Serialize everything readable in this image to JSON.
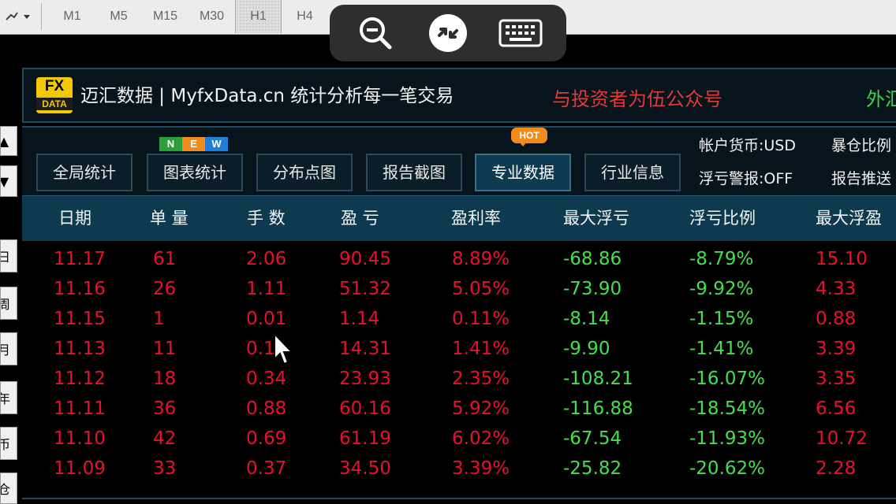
{
  "toolbar": {
    "timeframes": [
      "M1",
      "M5",
      "M15",
      "M30",
      "H1",
      "H4"
    ],
    "active_timeframe": "H1",
    "dropdown_icon": "chart-style-dropdown-icon"
  },
  "remote_controls": {
    "icons": [
      "zoom-out-icon",
      "remote-desktop-icon",
      "keyboard-icon"
    ]
  },
  "left_strip": {
    "arrows": [
      "▲",
      "▼"
    ],
    "buttons": [
      "日",
      "周",
      "月",
      "年",
      "币",
      "仓"
    ]
  },
  "banner": {
    "logo_top": "FX",
    "logo_bottom": "DATA",
    "brand_text": "迈汇数据 | MyfxData.cn  统计分析每一笔交易",
    "promo_text": "与投资者为伍公众号",
    "promo_text_2": "外汇",
    "colors": {
      "promo": "#e03a3a",
      "promo2": "#3fd04a",
      "logo": "#f2c800"
    }
  },
  "nav": {
    "buttons": [
      "全局统计",
      "图表统计",
      "分布点图",
      "报告截图",
      "专业数据",
      "行业信息"
    ],
    "active_index": 4,
    "new_badge": [
      "N",
      "E",
      "W"
    ],
    "new_badge_colors": [
      "#2e9e3a",
      "#f28a1c",
      "#1e7ed8"
    ],
    "hot_badge": "HOT",
    "account_currency": "帐户货币:USD",
    "exposure_ratio": "暴仓比例",
    "float_loss_alert": "浮亏警报:OFF",
    "report_push": "报告推送"
  },
  "table": {
    "headers": [
      "日期",
      "单 量",
      "手 数",
      "盈 亏",
      "盈利率",
      "最大浮亏",
      "浮亏比例",
      "最大浮盈"
    ],
    "rows": [
      [
        "11.17",
        "61",
        "2.06",
        "90.45",
        "8.89%",
        "-68.86",
        "-8.79%",
        "15.10"
      ],
      [
        "11.16",
        "26",
        "1.11",
        "51.32",
        "5.05%",
        "-73.90",
        "-9.92%",
        "4.33"
      ],
      [
        "11.15",
        "1",
        "0.01",
        "1.14",
        "0.11%",
        "-8.14",
        "-1.15%",
        "0.88"
      ],
      [
        "11.13",
        "11",
        "0.1",
        "14.31",
        "1.41%",
        "-9.90",
        "-1.41%",
        "3.39"
      ],
      [
        "11.12",
        "18",
        "0.34",
        "23.93",
        "2.35%",
        "-108.21",
        "-16.07%",
        "3.35"
      ],
      [
        "11.11",
        "36",
        "0.88",
        "60.16",
        "5.92%",
        "-116.88",
        "-18.54%",
        "6.56"
      ],
      [
        "11.10",
        "42",
        "0.69",
        "61.19",
        "6.02%",
        "-67.54",
        "-11.93%",
        "10.72"
      ],
      [
        "11.09",
        "33",
        "0.37",
        "34.50",
        "3.39%",
        "-25.82",
        "-20.62%",
        "2.28"
      ]
    ],
    "column_colors": [
      "red",
      "red",
      "red",
      "red",
      "red",
      "green",
      "green",
      "red"
    ],
    "colors": {
      "positive": "#e8102a",
      "negative": "#43e04a",
      "header_bg": "#0d3a4f"
    }
  }
}
